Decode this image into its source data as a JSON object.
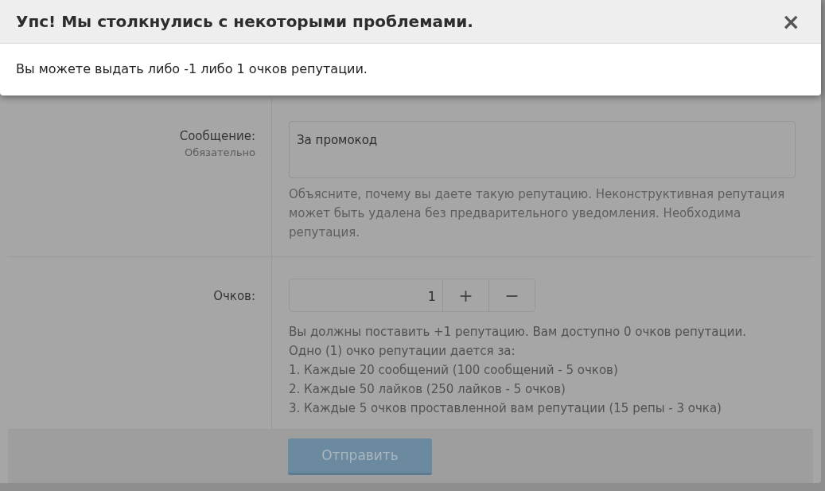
{
  "alert": {
    "title": "Упс! Мы столкнулись с некоторыми проблемами.",
    "close": "×",
    "message": "Вы можете выдать либо -1 либо 1 очков репутации."
  },
  "form": {
    "message_row": {
      "label": "Сообщение:",
      "hint": "Обязательно",
      "value": "За промокод",
      "explain": "Объясните, почему вы даете такую репутацию. Неконструктивная репутация может быть удалена без предварительного уведомления. Необходима репутация."
    },
    "points_row": {
      "label": "Очков:",
      "value": "1",
      "plus": "+",
      "minus": "−",
      "info": [
        "Вы должны поставить +1 репутацию. Вам доступно 0 очков репутации.",
        "Одно (1) очко репутации дается за:",
        "1. Каждые 20 сообщений (100 сообщений - 5 очков)",
        "2. Каждые 50 лайков (250 лайков - 5 очков)",
        "3. Каждые 5 очков проставленной вам репутации (15 репы - 3 очка)"
      ]
    },
    "submit": "Отправить"
  }
}
